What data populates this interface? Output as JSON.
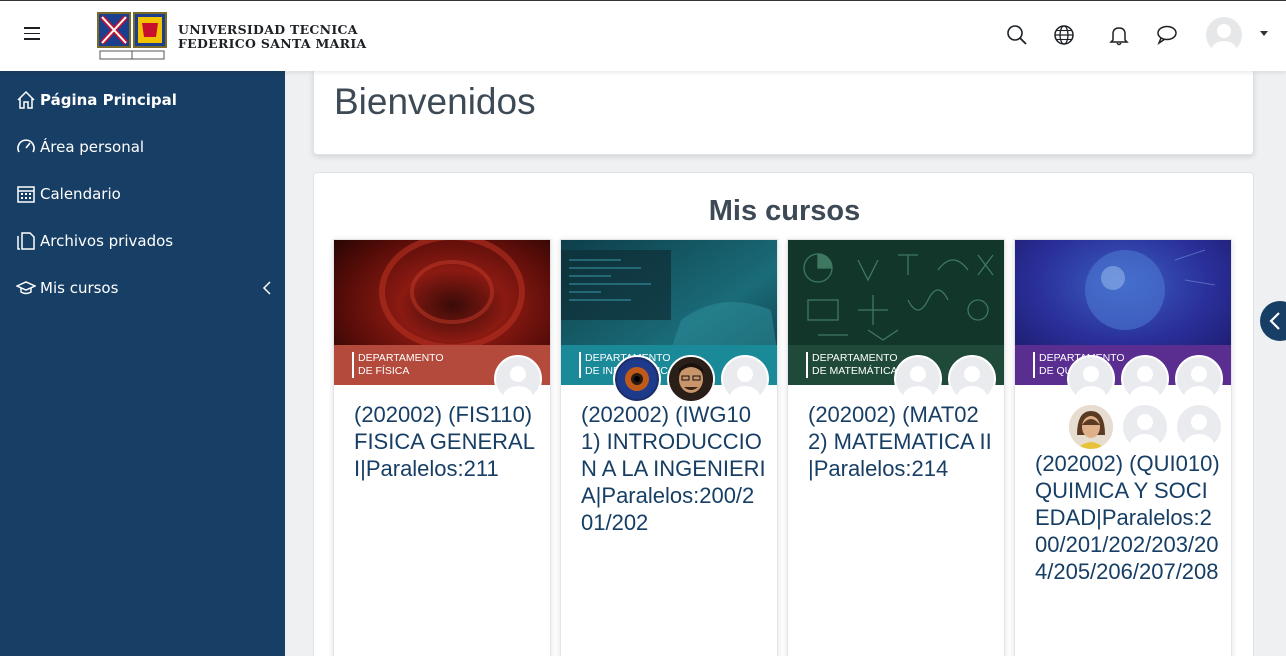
{
  "header": {
    "university_line1": "UNIVERSIDAD TECNICA",
    "university_line2": "FEDERICO SANTA MARIA",
    "icons": [
      "menu-icon",
      "search-icon",
      "globe-icon",
      "bell-icon",
      "chat-icon",
      "user-avatar",
      "caret-down-icon"
    ]
  },
  "sidebar": {
    "items": [
      {
        "label": "Página Principal",
        "icon": "home-icon"
      },
      {
        "label": "Área personal",
        "icon": "dashboard-icon"
      },
      {
        "label": "Calendario",
        "icon": "calendar-icon"
      },
      {
        "label": "Archivos privados",
        "icon": "files-icon"
      },
      {
        "label": "Mis cursos",
        "icon": "graduation-cap-icon"
      }
    ]
  },
  "main": {
    "page_title": "Bienvenidos",
    "block_title": "Mis cursos"
  },
  "courses": [
    {
      "dept_line1": "DEPARTAMENTO",
      "dept_line2": "DE FÍSICA",
      "name": "(202002) (FIS110) FISICA GENERAL I|Paralelos:211"
    },
    {
      "dept_line1": "DEPARTAMENTO",
      "dept_line2": "DE INFORMÁTICA",
      "name": "(202002) (IWG101) INTRODUCCION A LA INGENIERIA|Paralelos:200/201/202"
    },
    {
      "dept_line1": "DEPARTAMENTO",
      "dept_line2": "DE MATEMÁTICA",
      "name": "(202002) (MAT022) MATEMATICA II|Paralelos:214"
    },
    {
      "dept_line1": "DEPARTAMENTO",
      "dept_line2": "DE QUÍMICA",
      "name": "(202002) (QUI010) QUIMICA Y SOCIEDAD|Paralelos:200/201/202/203/204/205/206/207/208"
    }
  ],
  "colors": {
    "sidebar": "#173e64",
    "fisica_band": "#b34a3c",
    "informatica_band": "#1a8a99",
    "matematica_band": "#1f4a3a",
    "quimica_band": "#5a2d91"
  }
}
